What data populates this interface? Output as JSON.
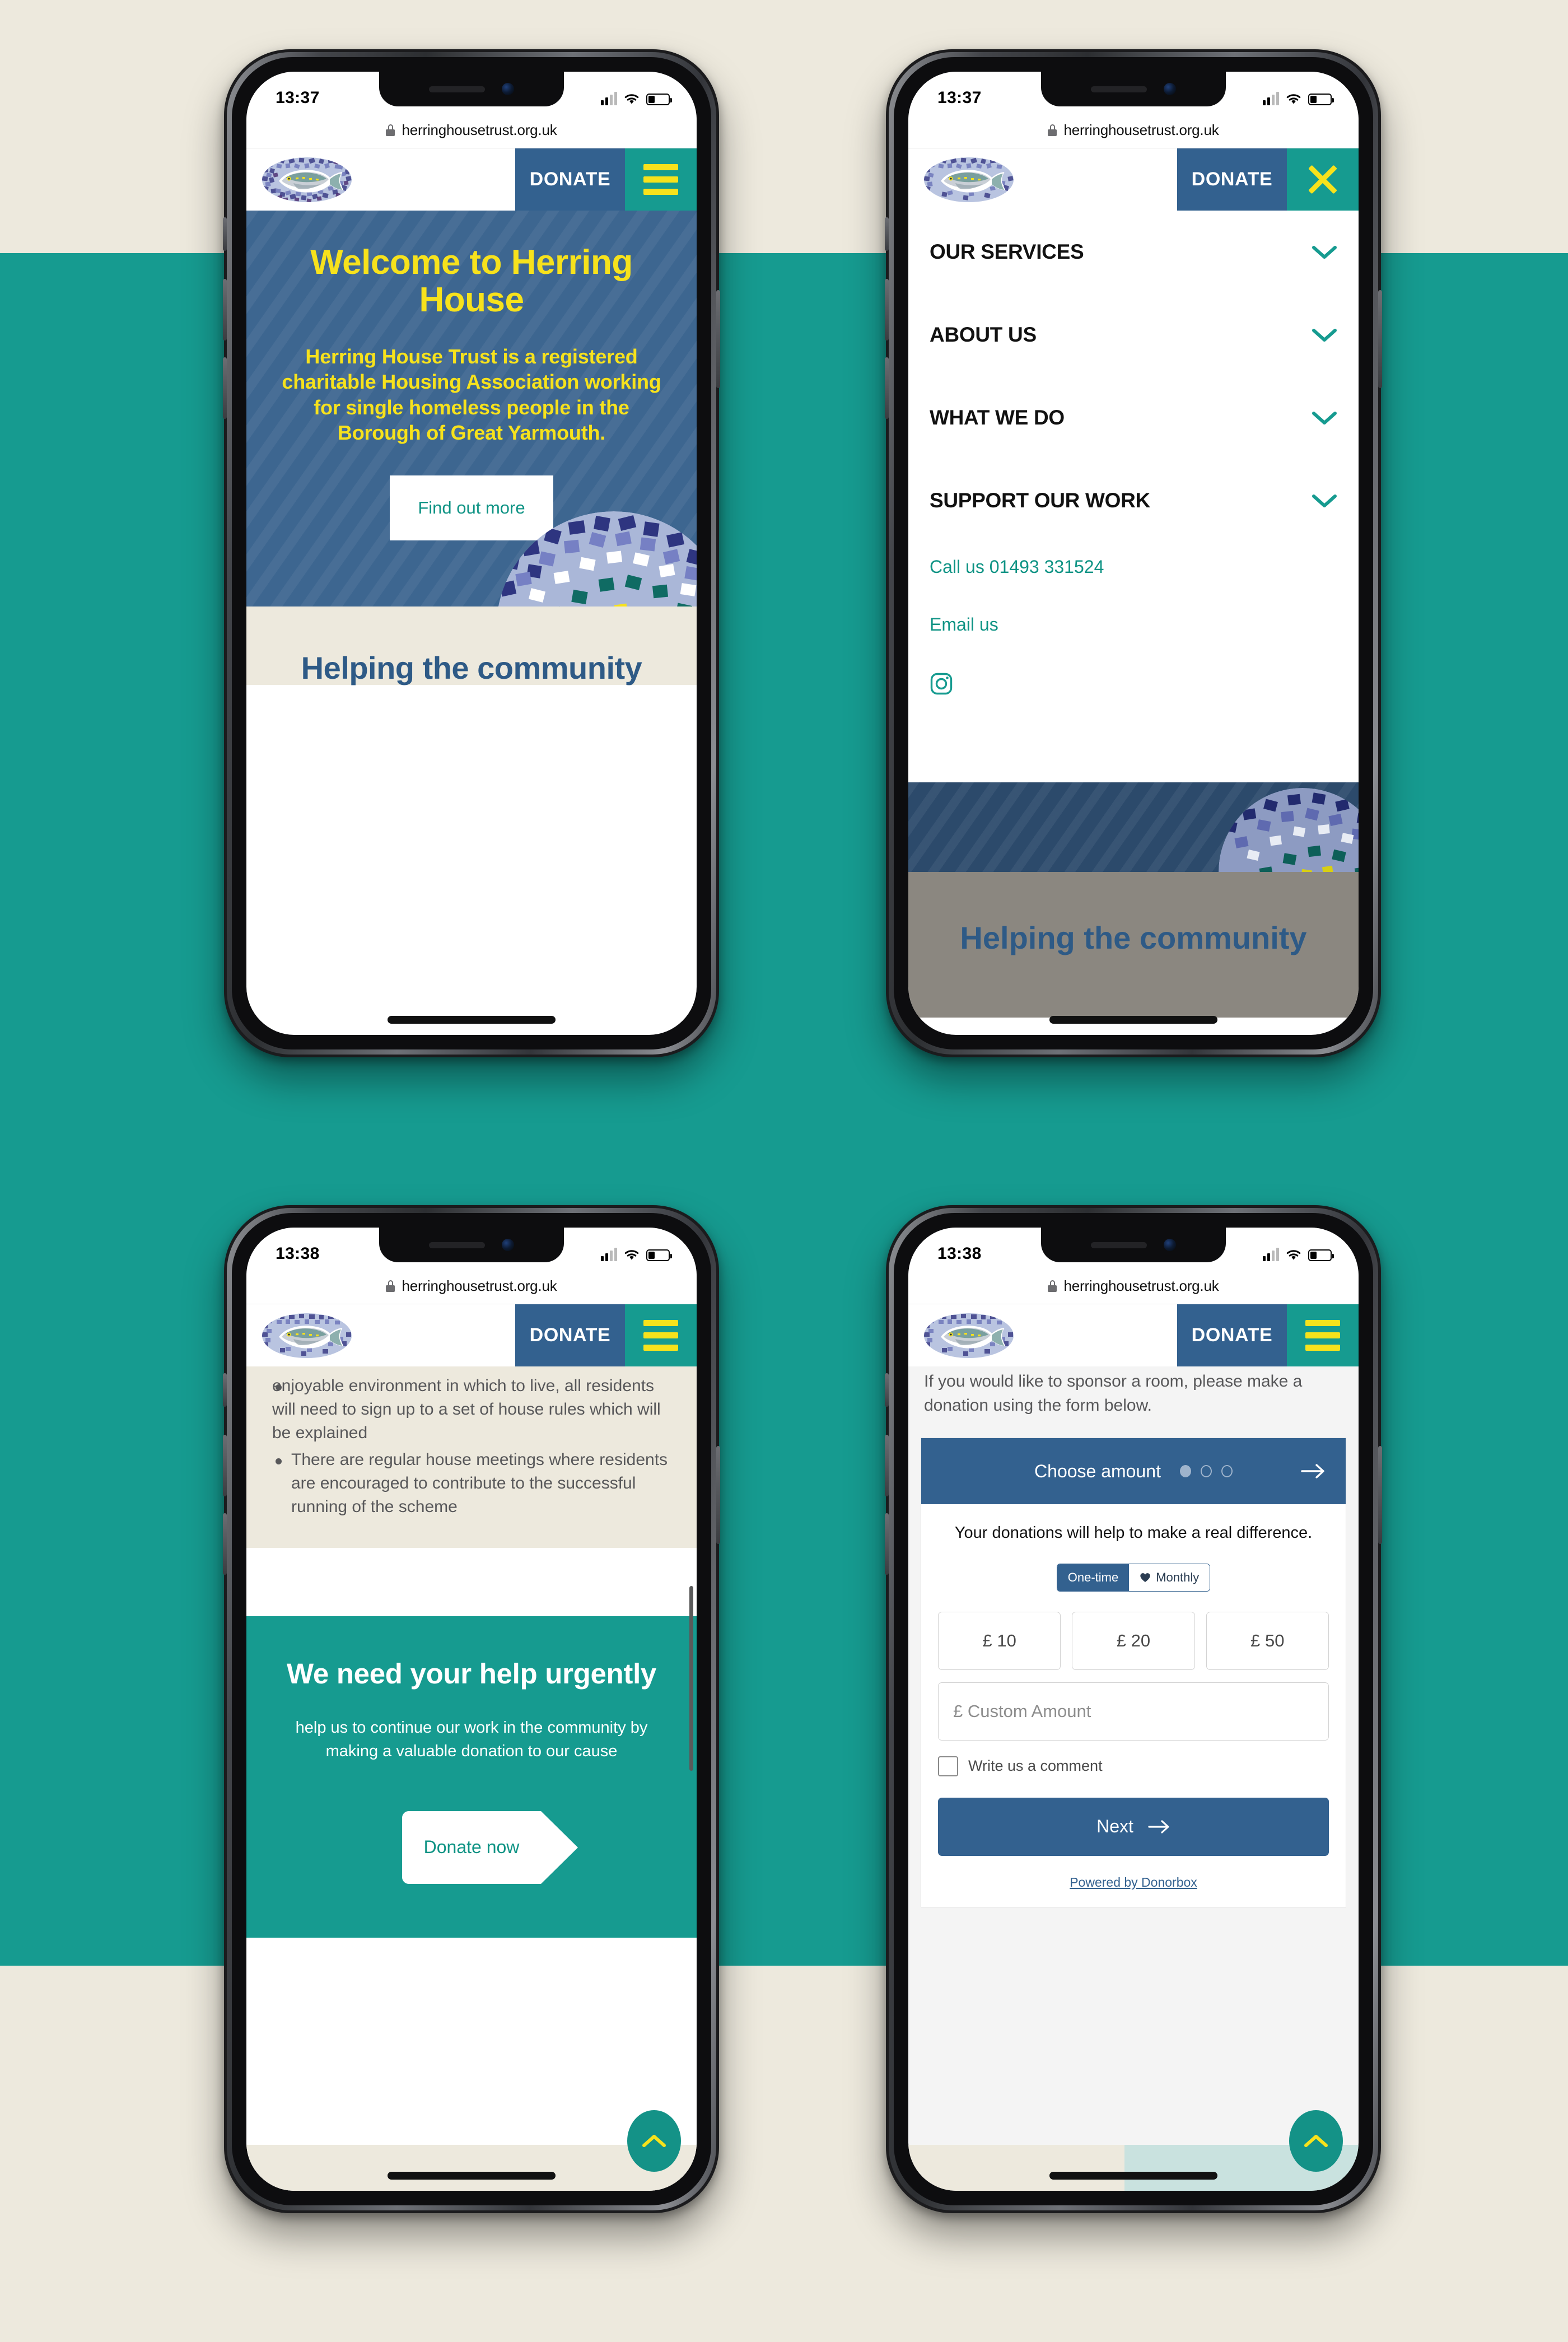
{
  "palette": {
    "page_cream": "#ede9dd",
    "page_teal": "#169b90",
    "brand_blue": "#33618f",
    "hero_blue": "#3d6690",
    "brand_teal": "#169b90",
    "brand_yellow": "#f7e21c",
    "heading_blue": "#2e5a86"
  },
  "phones": [
    {
      "id": "phone-home",
      "status": {
        "time": "13:37",
        "signal_icon": "signal-bars-icon",
        "wifi_icon": "wifi-icon",
        "battery_icon": "battery-low-icon"
      },
      "browser": {
        "lock_icon": "lock-icon",
        "url": "herringhousetrust.org.uk"
      },
      "header": {
        "logo_icon": "herring-mosaic-logo",
        "donate_label": "DONATE",
        "menu_icon": "hamburger-menu-icon"
      },
      "hero": {
        "title": "Welcome to Herring House",
        "body": "Herring House Trust is a registered charitable Housing Association working for single homeless people in the Borough of Great Yarmouth.",
        "cta_label": "Find out more",
        "mosaic_icon": "mosaic-circle-decoration"
      },
      "below": {
        "heading": "Helping the community"
      }
    },
    {
      "id": "phone-menu",
      "status": {
        "time": "13:37",
        "signal_icon": "signal-bars-icon",
        "wifi_icon": "wifi-icon",
        "battery_icon": "battery-low-icon"
      },
      "browser": {
        "lock_icon": "lock-icon",
        "url": "herringhousetrust.org.uk"
      },
      "header": {
        "logo_icon": "herring-mosaic-logo",
        "donate_label": "DONATE",
        "menu_icon": "close-x-icon"
      },
      "menu": {
        "items": [
          {
            "label": "OUR SERVICES",
            "chevron_icon": "chevron-down-icon"
          },
          {
            "label": "ABOUT US",
            "chevron_icon": "chevron-down-icon"
          },
          {
            "label": "WHAT WE DO",
            "chevron_icon": "chevron-down-icon"
          },
          {
            "label": "SUPPORT OUR WORK",
            "chevron_icon": "chevron-down-icon"
          }
        ],
        "call_label": "Call us 01493 331524",
        "email_label": "Email us",
        "social_icon": "instagram-icon"
      },
      "below": {
        "heading": "Helping the community"
      }
    },
    {
      "id": "phone-article",
      "status": {
        "time": "13:38",
        "signal_icon": "signal-bars-icon",
        "wifi_icon": "wifi-icon",
        "battery_icon": "battery-low-icon"
      },
      "browser": {
        "lock_icon": "lock-icon",
        "url": "herringhousetrust.org.uk"
      },
      "header": {
        "logo_icon": "herring-mosaic-logo",
        "donate_label": "DONATE",
        "menu_icon": "hamburger-menu-icon"
      },
      "article": {
        "bullets": [
          "enjoyable environment in which to live, all residents will need to sign up to a set of house rules which will be explained",
          "There are regular house meetings where residents are encouraged to contribute to the successful running of the scheme"
        ]
      },
      "help": {
        "heading": "We need your help urgently",
        "body": "help us to continue our work in the community by making a valuable donation to our cause",
        "cta_label": "Donate now"
      },
      "scroll_top_icon": "chevron-up-icon"
    },
    {
      "id": "phone-donate-form",
      "status": {
        "time": "13:38",
        "signal_icon": "signal-bars-icon",
        "wifi_icon": "wifi-icon",
        "battery_icon": "battery-low-icon"
      },
      "browser": {
        "lock_icon": "lock-icon",
        "url": "herringhousetrust.org.uk"
      },
      "header": {
        "logo_icon": "herring-mosaic-logo",
        "donate_label": "DONATE",
        "menu_icon": "hamburger-menu-icon"
      },
      "lead": "If you would like to sponsor a room, please make a donation using the form below.",
      "form": {
        "step_label": "Choose amount",
        "step_dots_total": 3,
        "step_dots_active": 1,
        "step_arrow_icon": "arrow-right-icon",
        "tagline": "Your donations will help to make a real difference.",
        "frequency": {
          "one_time_label": "One-time",
          "monthly_label": "Monthly",
          "monthly_icon": "heart-icon",
          "selected": "One-time"
        },
        "amounts": [
          "£ 10",
          "£ 20",
          "£ 50"
        ],
        "custom_placeholder": "£ Custom Amount",
        "custom_value": "",
        "comment_label": "Write us a comment",
        "comment_checked": false,
        "next_label": "Next",
        "next_icon": "arrow-right-icon",
        "powered_label": "Powered by Donorbox"
      },
      "scroll_top_icon": "chevron-up-icon"
    }
  ]
}
